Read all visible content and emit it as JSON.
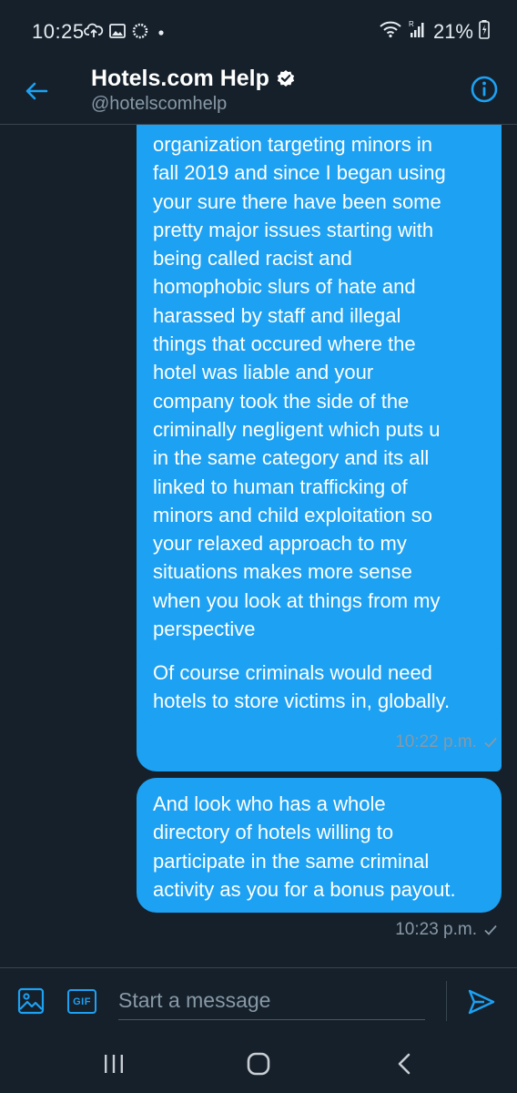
{
  "status_bar": {
    "time": "10:25",
    "battery": "21%",
    "icons": [
      "cloud-upload-icon",
      "image-icon",
      "sync-icon",
      "notification-dot-icon",
      "wifi-icon",
      "signal-icon",
      "battery-charging-icon"
    ]
  },
  "header": {
    "title": "Hotels.com Help",
    "handle": "@hotelscomhelp",
    "verified": true,
    "back_icon": "back-arrow-icon",
    "info_icon": "info-icon"
  },
  "messages": [
    {
      "text": "organization targeting minors in\nfall 2019 and since I began using\nyour sure there have been some\npretty major issues starting with\nbeing called racist and\nhomophobic slurs of hate and\nharassed by staff and illegal\nthings that occured where the\nhotel was liable and your\ncompany took the side of the\ncriminally negligent which puts u\nin the same category and its all\nlinked to human trafficking of\nminors and child exploitation so\nyour relaxed approach to my\nsituations makes more sense\nwhen you look at things from my\nperspective",
      "sender": "self"
    },
    {
      "text": "Of course criminals would need\nhotels to store  victims in, globally.",
      "sender": "self",
      "timestamp": "10:22 p.m."
    },
    {
      "text": "And look who has a whole\ndirectory of hotels willing to\nparticipate in the same criminal\nactivity as you for a bonus payout.",
      "sender": "self",
      "timestamp": "10:23 p.m."
    }
  ],
  "composer": {
    "placeholder": "Start a message",
    "gif_label": "GIF",
    "image_icon": "image-icon",
    "send_icon": "send-icon"
  },
  "colors": {
    "background": "#15202b",
    "bubble": "#1da1f2",
    "accent": "#1da1f2",
    "muted_text": "#8899a6"
  }
}
